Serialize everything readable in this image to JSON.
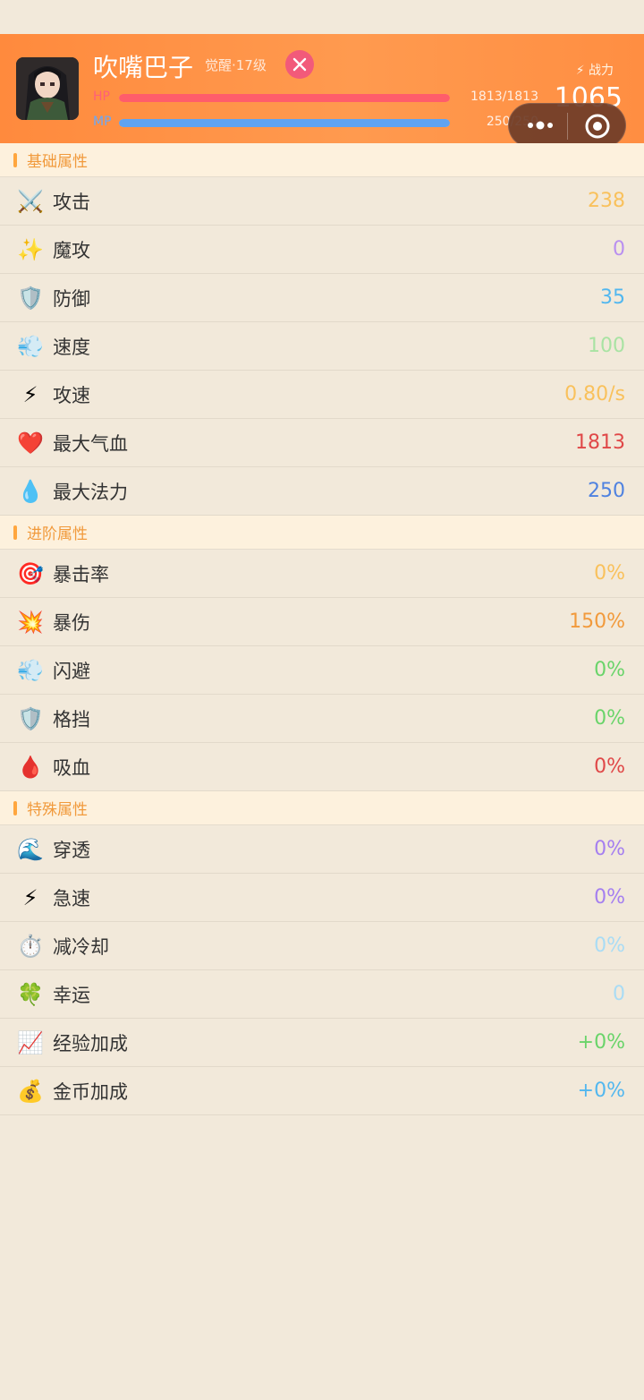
{
  "profile": {
    "name": "吹嘴巴子",
    "subtitle": "觉醒·17级",
    "hp_label": "HP",
    "hp_value": "1813/1813",
    "hp_fraction": 1.0,
    "mp_label": "MP",
    "mp_value": "250/250",
    "mp_fraction": 1.0,
    "power_label": "⚡ 战力",
    "power_value": "1065"
  },
  "sections": {
    "basic": {
      "title": "基础属性",
      "rows": [
        {
          "icon": "crossed-swords-icon",
          "glyph": "⚔️",
          "label": "攻击",
          "value": "238",
          "color": "#f9c15c"
        },
        {
          "icon": "sparkles-icon",
          "glyph": "✨",
          "label": "魔攻",
          "value": "0",
          "color": "#b98ff0"
        },
        {
          "icon": "shield-icon",
          "glyph": "🛡️",
          "label": "防御",
          "value": "35",
          "color": "#52b7ef"
        },
        {
          "icon": "wind-icon",
          "glyph": "💨",
          "label": "速度",
          "value": "100",
          "color": "#a9e3a3"
        },
        {
          "icon": "lightning-icon",
          "glyph": "⚡",
          "label": "攻速",
          "value": "0.80/s",
          "color": "#f9c15c"
        },
        {
          "icon": "heart-icon",
          "glyph": "❤️",
          "label": "最大气血",
          "value": "1813",
          "color": "#e04848"
        },
        {
          "icon": "droplet-icon",
          "glyph": "💧",
          "label": "最大法力",
          "value": "250",
          "color": "#4f82e0"
        }
      ]
    },
    "advanced": {
      "title": "进阶属性",
      "rows": [
        {
          "icon": "target-icon",
          "glyph": "🎯",
          "label": "暴击率",
          "value": "0%",
          "color": "#f9c15c"
        },
        {
          "icon": "explosion-icon",
          "glyph": "💥",
          "label": "暴伤",
          "value": "150%",
          "color": "#f29a3c"
        },
        {
          "icon": "wind-icon",
          "glyph": "💨",
          "label": "闪避",
          "value": "0%",
          "color": "#6ad46a"
        },
        {
          "icon": "shield-icon",
          "glyph": "🛡️",
          "label": "格挡",
          "value": "0%",
          "color": "#6ad46a"
        },
        {
          "icon": "blood-drop-icon",
          "glyph": "🩸",
          "label": "吸血",
          "value": "0%",
          "color": "#e04848"
        }
      ]
    },
    "special": {
      "title": "特殊属性",
      "rows": [
        {
          "icon": "wave-icon",
          "glyph": "🌊",
          "label": "穿透",
          "value": "0%",
          "color": "#a57ff0"
        },
        {
          "icon": "lightning-icon",
          "glyph": "⚡",
          "label": "急速",
          "value": "0%",
          "color": "#a57ff0"
        },
        {
          "icon": "stopwatch-icon",
          "glyph": "⏱️",
          "label": "减冷却",
          "value": "0%",
          "color": "#a9dcf5"
        },
        {
          "icon": "clover-icon",
          "glyph": "🍀",
          "label": "幸运",
          "value": "0",
          "color": "#a9dcf5"
        },
        {
          "icon": "chart-up-icon",
          "glyph": "📈",
          "label": "经验加成",
          "value": "+0%",
          "color": "#6ad46a"
        },
        {
          "icon": "money-bag-icon",
          "glyph": "💰",
          "label": "金币加成",
          "value": "+0%",
          "color": "#52b7ef"
        }
      ]
    }
  }
}
